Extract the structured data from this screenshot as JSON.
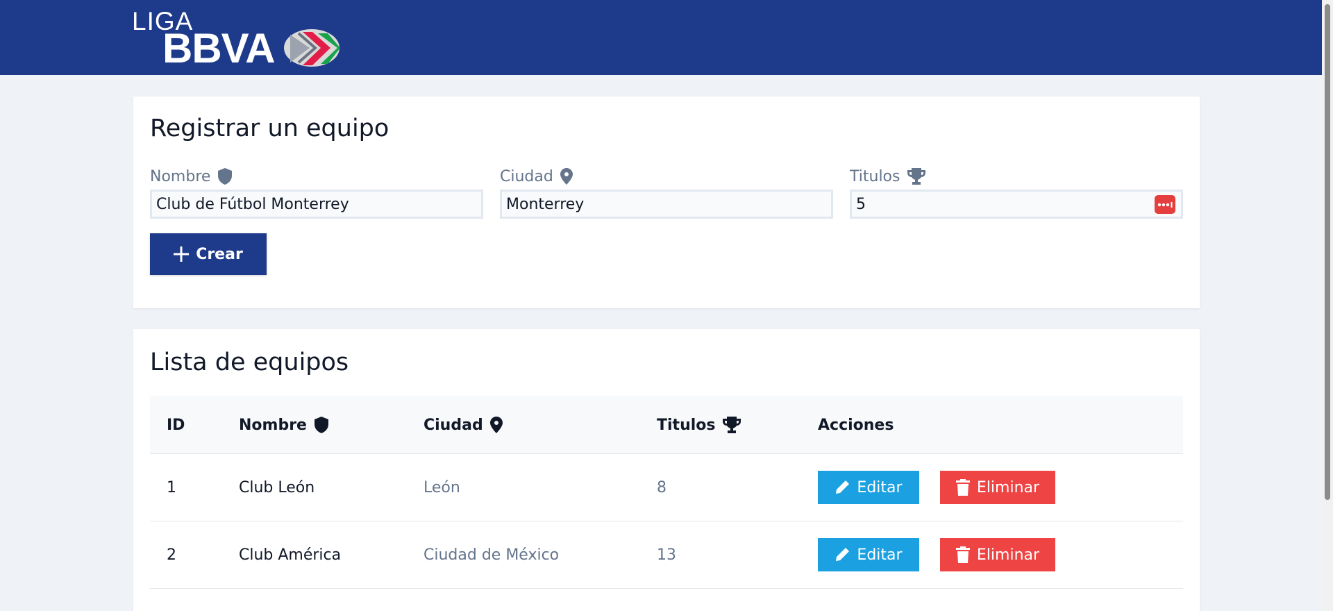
{
  "brand": {
    "logo_line1": "LIGA",
    "logo_line2": "BBVA"
  },
  "create_card": {
    "title": "Registrar un equipo",
    "fields": [
      {
        "label": "Nombre",
        "value": "Club de Fútbol Monterrey",
        "icon": "shield-icon"
      },
      {
        "label": "Ciudad",
        "value": "Monterrey",
        "icon": "location-pin-icon"
      },
      {
        "label": "Titulos",
        "value": "5",
        "icon": "trophy-icon"
      }
    ],
    "create_button": "Crear"
  },
  "list_card": {
    "title": "Lista de equipos",
    "columns": [
      "ID",
      "Nombre",
      "Ciudad",
      "Titulos",
      "Acciones"
    ],
    "rows": [
      {
        "id": "1",
        "nombre": "Club León",
        "ciudad": "León",
        "titulos": "8"
      },
      {
        "id": "2",
        "nombre": "Club América",
        "ciudad": "Ciudad de México",
        "titulos": "13"
      }
    ],
    "edit_label": "Editar",
    "delete_label": "Eliminar"
  },
  "colors": {
    "primary": "#1e3a8a",
    "edit": "#1ba1e2",
    "delete": "#ef4444",
    "background": "#eff2f7"
  }
}
